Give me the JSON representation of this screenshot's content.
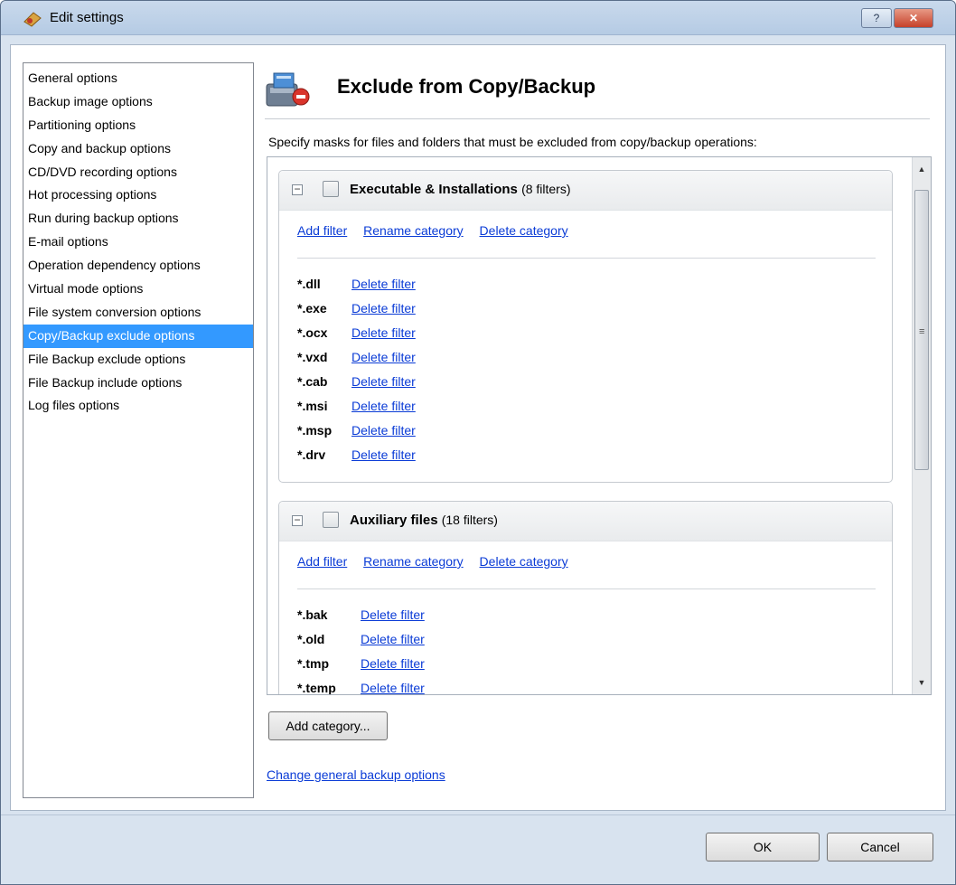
{
  "window": {
    "title": "Edit settings",
    "help_label": "?",
    "close_label": "✕"
  },
  "sidebar": {
    "items": [
      {
        "label": "General options"
      },
      {
        "label": "Backup image options"
      },
      {
        "label": "Partitioning options"
      },
      {
        "label": "Copy and backup options"
      },
      {
        "label": "CD/DVD recording options"
      },
      {
        "label": "Hot processing options"
      },
      {
        "label": "Run during backup options"
      },
      {
        "label": "E-mail options"
      },
      {
        "label": "Operation dependency options"
      },
      {
        "label": "Virtual mode options"
      },
      {
        "label": "File system conversion options"
      },
      {
        "label": "Copy/Backup exclude options",
        "selected": true
      },
      {
        "label": "File Backup exclude options"
      },
      {
        "label": "File Backup include options"
      },
      {
        "label": "Log files options"
      }
    ]
  },
  "main": {
    "title": "Exclude from Copy/Backup",
    "instructions": "Specify masks for files and folders that must be excluded from copy/backup operations:",
    "categories": [
      {
        "name": "Executable & Installations",
        "count_label": "(8 filters)",
        "checked": false,
        "actions": {
          "add": "Add filter",
          "rename": "Rename category",
          "delete": "Delete category"
        },
        "filters": [
          {
            "mask": "*.dll",
            "action": "Delete filter"
          },
          {
            "mask": "*.exe",
            "action": "Delete filter"
          },
          {
            "mask": "*.ocx",
            "action": "Delete filter"
          },
          {
            "mask": "*.vxd",
            "action": "Delete filter"
          },
          {
            "mask": "*.cab",
            "action": "Delete filter"
          },
          {
            "mask": "*.msi",
            "action": "Delete filter"
          },
          {
            "mask": "*.msp",
            "action": "Delete filter"
          },
          {
            "mask": "*.drv",
            "action": "Delete filter"
          }
        ]
      },
      {
        "name": "Auxiliary files",
        "count_label": "(18 filters)",
        "checked": false,
        "actions": {
          "add": "Add filter",
          "rename": "Rename category",
          "delete": "Delete category"
        },
        "filters": [
          {
            "mask": "*.bak",
            "action": "Delete filter"
          },
          {
            "mask": "*.old",
            "action": "Delete filter"
          },
          {
            "mask": "*.tmp",
            "action": "Delete filter"
          },
          {
            "mask": "*.temp",
            "action": "Delete filter"
          }
        ]
      }
    ],
    "add_category_label": "Add category...",
    "change_link_label": "Change general backup options"
  },
  "footer": {
    "ok_label": "OK",
    "cancel_label": "Cancel"
  },
  "colors": {
    "selection": "#3399ff",
    "link": "#0a3bd6",
    "close_button": "#c6412a"
  }
}
